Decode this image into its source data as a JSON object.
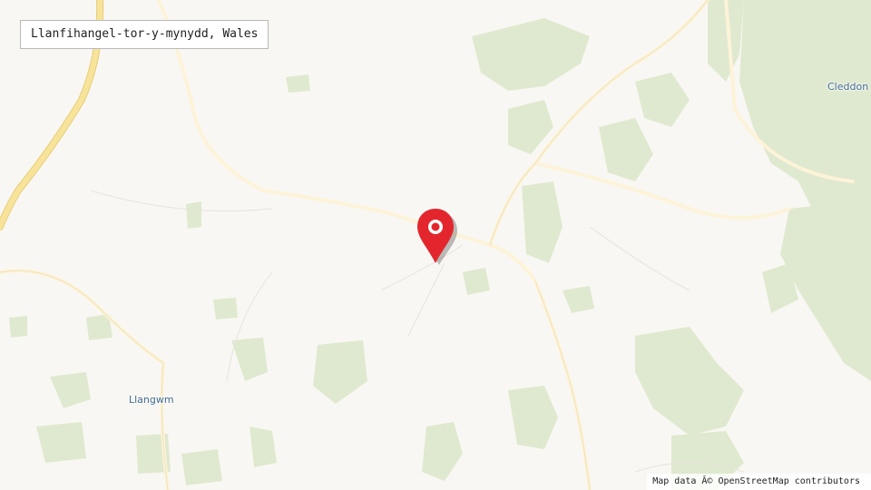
{
  "search": {
    "place_name": "Llanfihangel-tor-y-mynydd, Wales"
  },
  "map": {
    "background_color": "#f9f7f3",
    "woodland_color": "#dfe9cf",
    "minor_road_color": "#fdf3d8",
    "major_road_color": "#f8e39a",
    "labels": {
      "cleddon": "Cleddon",
      "llangwm": "Llangwm"
    },
    "marker": {
      "icon": "map-pin-icon",
      "color": "#e3262d"
    }
  },
  "footer": {
    "attribution": "Map data Â© OpenStreetMap contributors"
  }
}
